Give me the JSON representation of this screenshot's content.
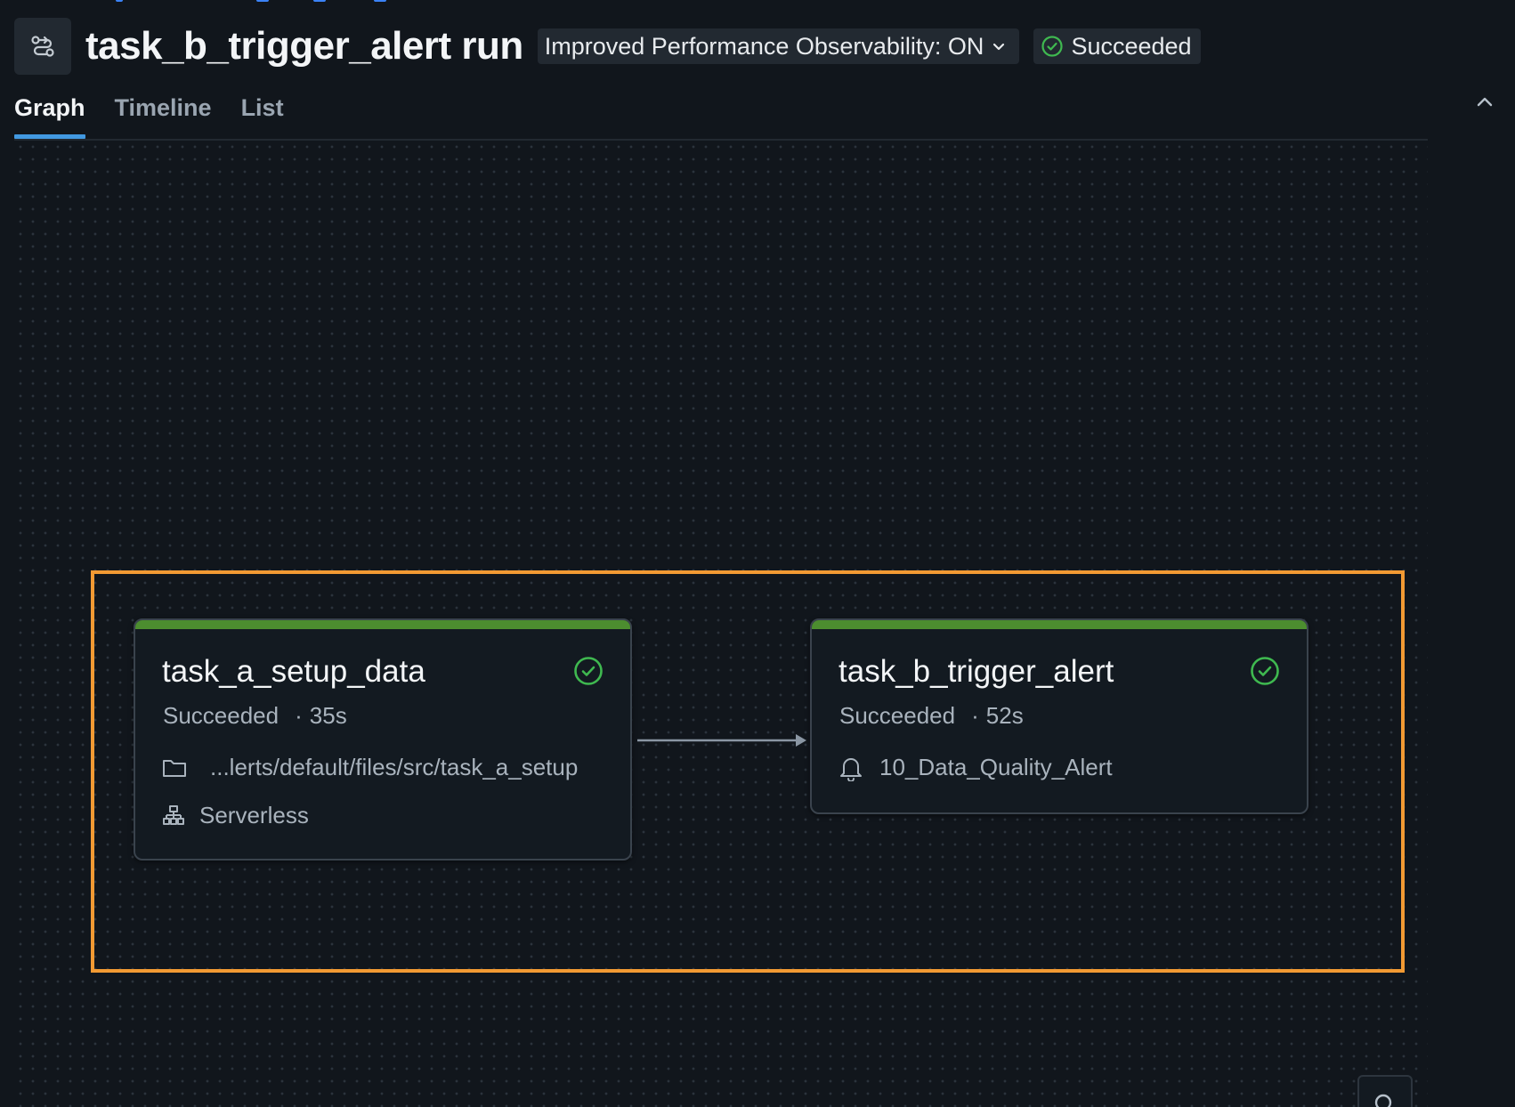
{
  "header": {
    "title": "task_b_trigger_alert run",
    "observability_label": "Improved Performance Observability: ON",
    "status_label": "Succeeded"
  },
  "tabs": [
    {
      "label": "Graph",
      "active": true
    },
    {
      "label": "Timeline",
      "active": false
    },
    {
      "label": "List",
      "active": false
    }
  ],
  "graph": {
    "nodes": [
      {
        "name": "task_a_setup_data",
        "status": "Succeeded",
        "duration": "35s",
        "path": "...lerts/default/files/src/task_a_setup",
        "compute": "Serverless"
      },
      {
        "name": "task_b_trigger_alert",
        "status": "Succeeded",
        "duration": "52s",
        "alert": "10_Data_Quality_Alert"
      }
    ]
  },
  "colors": {
    "background": "#11161c",
    "success": "#3fb950",
    "status_bar": "#4c8d2f",
    "selection": "#f29a33",
    "active_tab": "#4299e1"
  }
}
